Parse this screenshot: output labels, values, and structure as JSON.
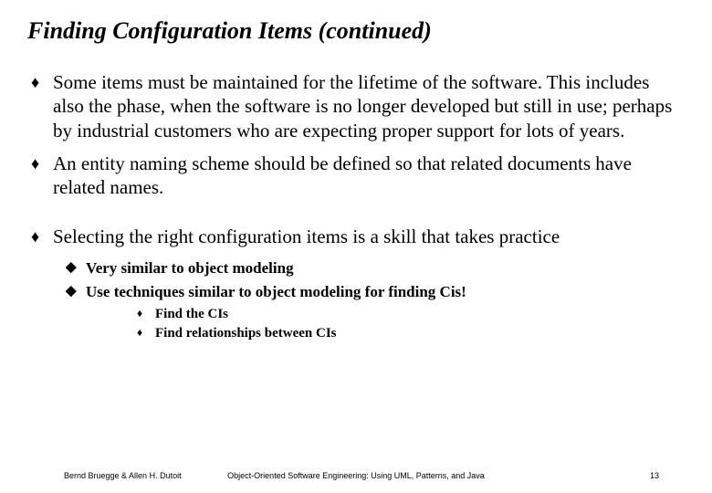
{
  "title": "Finding Configuration Items (continued)",
  "bullets": {
    "b1": "Some items must be maintained for the lifetime of the software. This includes also the phase, when the software is no longer developed but still in use; perhaps by industrial customers who are expecting proper support for lots of years.",
    "b2": "An entity naming scheme should be defined so that related documents have related names.",
    "b3": "Selecting the right configuration items is a skill that takes practice",
    "b3_1": "Very similar to object modeling",
    "b3_2": "Use techniques similar to object modeling for finding Cis!",
    "b3_2_1": "Find the CIs",
    "b3_2_2": "Find relationships between CIs"
  },
  "footer": {
    "left": "Bernd Bruegge & Allen H. Dutoit",
    "center": "Object-Oriented Software Engineering: Using UML, Patterns, and Java",
    "right": "13"
  },
  "glyphs": {
    "diamond": "♦",
    "arrow": "◆"
  }
}
